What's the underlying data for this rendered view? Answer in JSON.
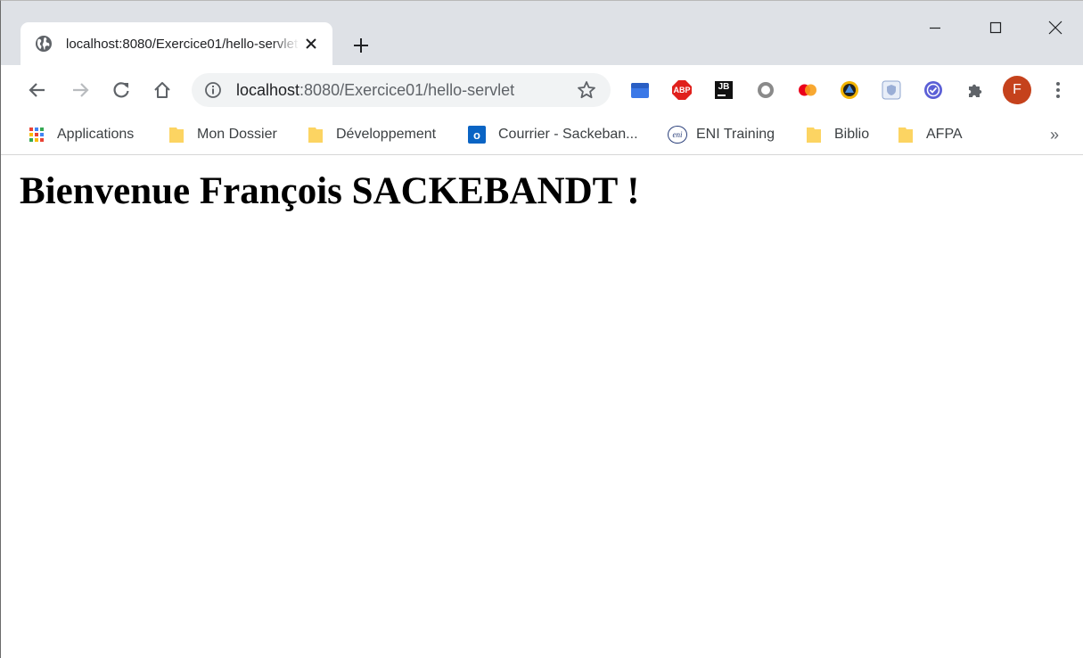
{
  "tab": {
    "title": "localhost:8080/Exercice01/hello-servlet"
  },
  "omnibox": {
    "host": "localhost",
    "path": ":8080/Exercice01/hello-servlet"
  },
  "window_controls": [
    "minimize-icon",
    "maximize-icon",
    "close-icon"
  ],
  "toolbar_icons": [
    "back-arrow-icon",
    "forward-arrow-icon",
    "reload-icon",
    "home-icon",
    "info-icon",
    "star-icon"
  ],
  "extensions": [
    {
      "name": "calendar-extension-icon"
    },
    {
      "name": "adblock-plus-icon",
      "label": "ABP"
    },
    {
      "name": "jetbrains-icon",
      "label": "JB"
    },
    {
      "name": "circle-extension-icon"
    },
    {
      "name": "mastercard-icon"
    },
    {
      "name": "sparrow-extension-icon"
    },
    {
      "name": "shield-extension-icon"
    },
    {
      "name": "check-extension-icon"
    },
    {
      "name": "puzzle-icon"
    },
    {
      "name": "profile-avatar",
      "label": "F"
    },
    {
      "name": "more-menu-icon"
    }
  ],
  "bookmarks": {
    "items": [
      {
        "label": "Applications",
        "icon": "apps-grid-icon"
      },
      {
        "label": "Mon Dossier",
        "icon": "folder-icon"
      },
      {
        "label": "Développement",
        "icon": "folder-icon"
      },
      {
        "label": "Courrier - Sackeban...",
        "icon": "outlook-icon",
        "icon_label": "o"
      },
      {
        "label": "ENI Training",
        "icon": "eni-icon",
        "icon_label": "eni"
      },
      {
        "label": "Biblio",
        "icon": "folder-icon"
      },
      {
        "label": "AFPA",
        "icon": "folder-icon"
      }
    ],
    "more_label": "»"
  },
  "page": {
    "heading": "Bienvenue François SACKEBANDT !"
  },
  "colors": {
    "frame": "#dee1e6",
    "omnibox_bg": "#f1f3f4",
    "folder": "#fcd462",
    "avatar": "#c5421c"
  }
}
